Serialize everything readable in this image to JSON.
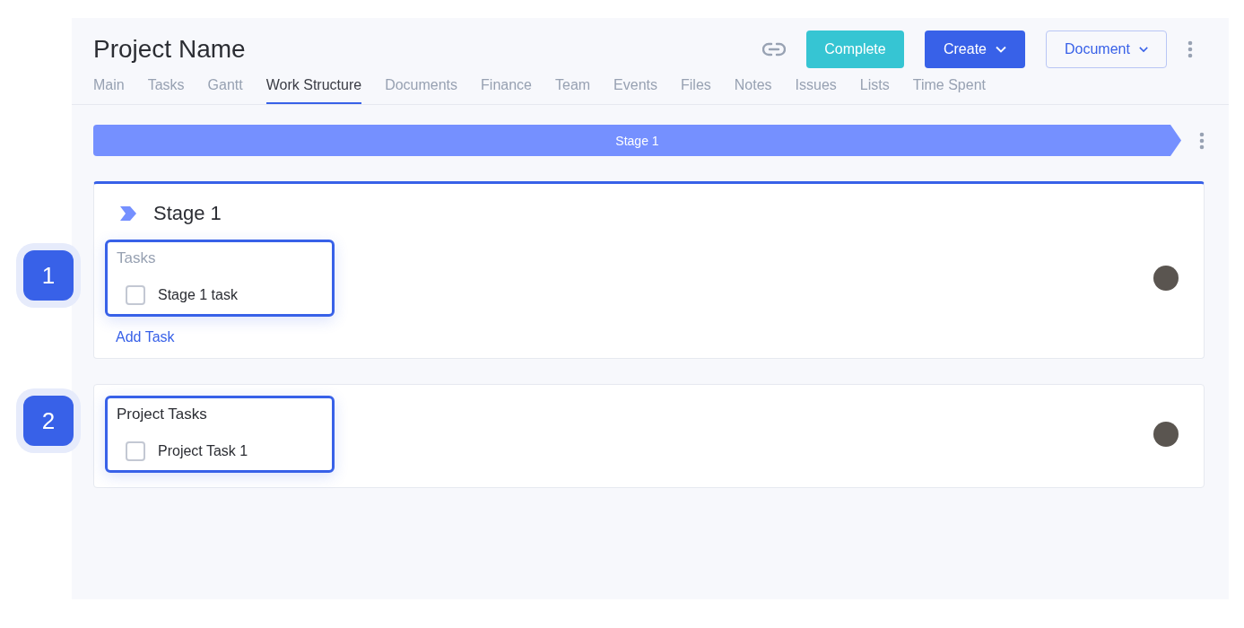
{
  "project": {
    "title": "Project Name"
  },
  "actions": [
    {
      "kind": "icon"
    },
    {
      "kind": "teal",
      "label": "Complete"
    },
    {
      "kind": "primary",
      "label": "Create"
    },
    {
      "kind": "outline",
      "label": "Document"
    }
  ],
  "tabs": [
    {
      "label": "Main",
      "selected": false
    },
    {
      "label": "Tasks",
      "selected": false
    },
    {
      "label": "Gantt",
      "selected": false
    },
    {
      "label": "Work Structure",
      "selected": true
    },
    {
      "label": "Documents",
      "selected": false
    },
    {
      "label": "Finance",
      "selected": false
    },
    {
      "label": "Team",
      "selected": false
    },
    {
      "label": "Events",
      "selected": false
    },
    {
      "label": "Files",
      "selected": false
    },
    {
      "label": "Notes",
      "selected": false
    },
    {
      "label": "Issues",
      "selected": false
    },
    {
      "label": "Lists",
      "selected": false
    },
    {
      "label": "Time Spent",
      "selected": false
    }
  ],
  "stage_bar": {
    "label": "Stage 1"
  },
  "sections": [
    {
      "kind": "stage",
      "title": "Stage 1",
      "callout": "1",
      "group_heading": "Tasks",
      "tasks": [
        {
          "name": "Stage 1 task",
          "checked": false
        }
      ],
      "add_label": "Add Task"
    },
    {
      "kind": "project",
      "callout": "2",
      "group_heading": "Project Tasks",
      "tasks": [
        {
          "name": "Project Task 1",
          "checked": false
        }
      ]
    }
  ]
}
